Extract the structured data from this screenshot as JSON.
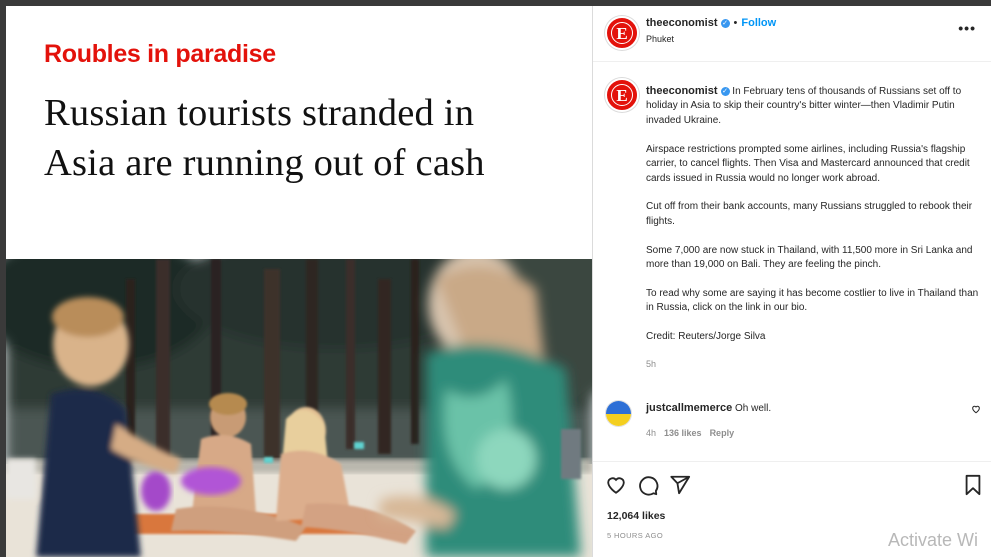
{
  "media": {
    "kicker": "Roubles in paradise",
    "headline_line1": "Russian tourists stranded in",
    "headline_line2": "Asia are running out of cash"
  },
  "header": {
    "username": "theeconomist",
    "dot": "•",
    "follow_label": "Follow",
    "location": "Phuket",
    "more_label": "•••",
    "avatar_letter": "E"
  },
  "caption": {
    "username": "theeconomist",
    "p1": "In February tens of thousands of Russians set off to holiday in Asia to skip their country's bitter winter—then Vladimir Putin invaded Ukraine.",
    "p2": "Airspace restrictions prompted some airlines, including Russia's flagship carrier, to cancel flights. Then Visa and Mastercard announced that credit cards issued in Russia would no longer work abroad.",
    "p3": "Cut off from their bank accounts, many Russians struggled to rebook their flights.",
    "p4": "Some 7,000 are now stuck in Thailand, with 11,500 more in Sri Lanka and more than 19,000 on Bali. They are feeling the pinch.",
    "p5": "To read why some are saying it has become costlier to live in Thailand than in Russia, click on the link in our bio.",
    "p6": "Credit: Reuters/Jorge Silva",
    "time": "5h"
  },
  "comment": {
    "username": "justcallmemerce",
    "text": "Oh well.",
    "time": "4h",
    "likes": "136 likes",
    "reply_label": "Reply"
  },
  "actions": {
    "likes_count": "12,064 likes",
    "posted_ago": "5 HOURS AGO"
  },
  "watermark": "Activate Wi",
  "colors": {
    "economist_red": "#e3120b",
    "link_blue": "#0095f6",
    "muted": "#8e8e8e",
    "text": "#262626"
  }
}
